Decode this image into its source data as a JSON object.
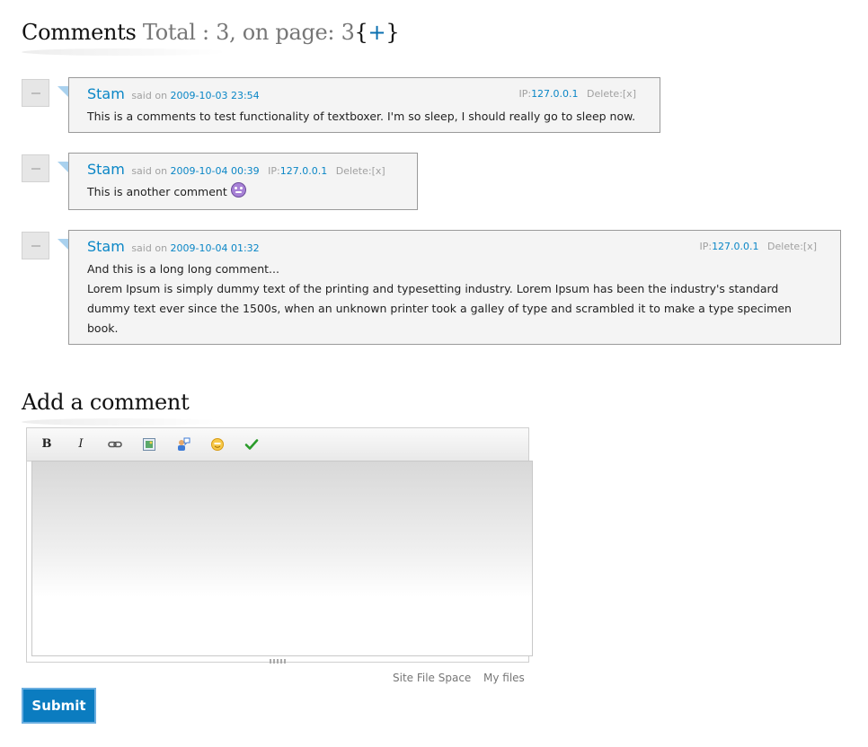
{
  "comments_header": {
    "title": "Comments",
    "total_label": "Total :",
    "total_count": "3,",
    "on_page_label": "on page:",
    "on_page_count": "3",
    "open_brace": "{",
    "plus": "+",
    "close_brace": "}"
  },
  "comments": [
    {
      "author": "Stam",
      "said_on": "said on",
      "date": "2009-10-03 23:54",
      "ip_label": "IP:",
      "ip": "127.0.0.1",
      "delete": "Delete:[x]",
      "lines": [
        "This is a comments to test functionality of textboxer. I'm so sleep, I should really go to sleep now."
      ]
    },
    {
      "author": "Stam",
      "said_on": "said on",
      "date": "2009-10-04 00:39",
      "ip_label": "IP:",
      "ip": "127.0.0.1",
      "delete": "Delete:[x]",
      "lines": [
        "This is another comment"
      ],
      "emoticon": "devil-smiley-icon"
    },
    {
      "author": "Stam",
      "said_on": "said on",
      "date": "2009-10-04 01:32",
      "ip_label": "IP:",
      "ip": "127.0.0.1",
      "delete": "Delete:[x]",
      "lines": [
        "And this is a long long comment...",
        "Lorem Ipsum is simply dummy text of the printing and typesetting industry. Lorem Ipsum has been the industry's standard dummy text ever since the 1500s, when an unknown printer took a galley of type and scrambled it to make a type specimen book."
      ]
    }
  ],
  "add_comment": {
    "title": "Add a comment",
    "toolbar": {
      "bold": "B",
      "italic": "I",
      "icons": [
        "bold-icon",
        "italic-icon",
        "link-icon",
        "image-icon",
        "quote-icon",
        "smiley-icon",
        "check-icon"
      ]
    },
    "links": {
      "site_file_space": "Site File Space",
      "my_files": "My files"
    },
    "submit": "Submit"
  },
  "colors": {
    "accent": "#0a86c6",
    "submit_bg": "#0b7cc0"
  }
}
